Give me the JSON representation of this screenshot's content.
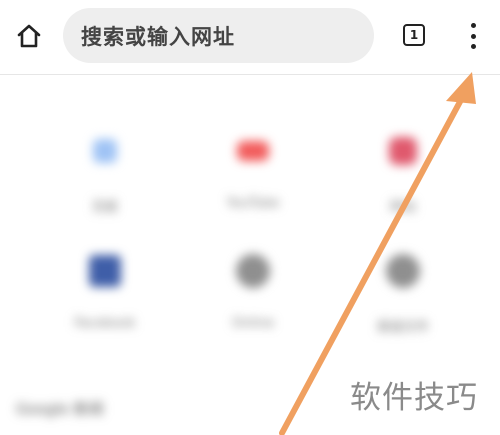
{
  "toolbar": {
    "home_icon": "home-icon",
    "omnibox_placeholder": "搜索或输入网址",
    "tab_count": "1",
    "menu_icon": "more-vert-icon"
  },
  "shortcuts": [
    {
      "label": "百度",
      "icon": "baidu-icon",
      "color": "#9fc3f5"
    },
    {
      "label": "YouTube",
      "icon": "youtube-icon",
      "color": "#f25c5c"
    },
    {
      "label": "网站",
      "icon": "site-icon",
      "color": "#e0596d"
    },
    {
      "label": "Facebook",
      "icon": "facebook-icon",
      "color": "#3f5ea8"
    },
    {
      "label": "Online",
      "icon": "globe-icon",
      "color": "#8f8f8f"
    },
    {
      "label": "报道文件",
      "icon": "globe-icon",
      "color": "#8f8f8f"
    }
  ],
  "section": {
    "title": "Google 新闻"
  },
  "watermark": "软件技巧",
  "annotation": {
    "arrow_color": "#f0a060"
  }
}
